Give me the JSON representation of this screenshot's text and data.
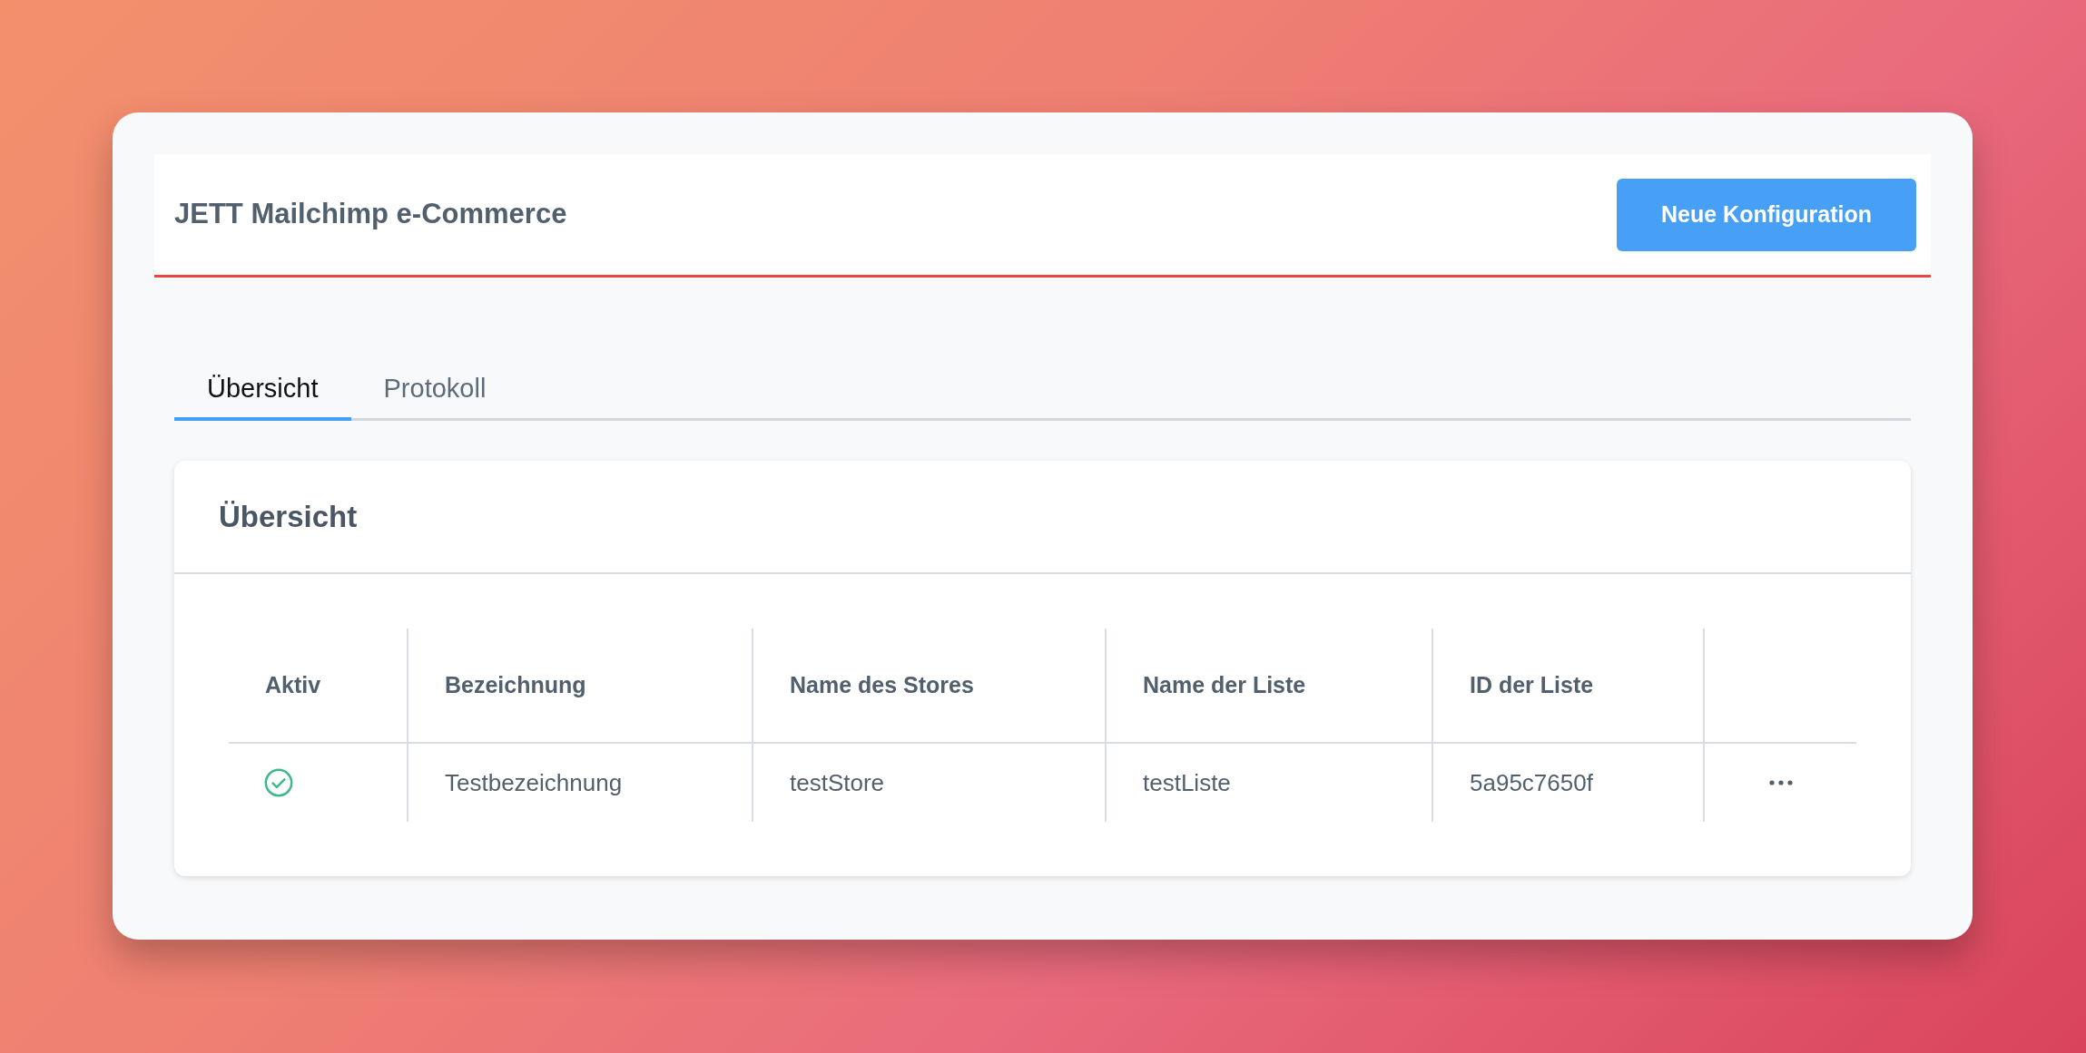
{
  "header": {
    "title": "JETT Mailchimp e-Commerce",
    "button": "Neue Konfiguration"
  },
  "tabs": [
    {
      "label": "Übersicht",
      "selected": true
    },
    {
      "label": "Protokoll",
      "selected": false
    }
  ],
  "panel": {
    "title": "Übersicht",
    "table": {
      "columns": [
        "Aktiv",
        "Bezeichnung",
        "Name des Stores",
        "Name der Liste",
        "ID der Liste"
      ],
      "rows": [
        {
          "cells": [
            {
              "kind": "status",
              "active": true
            },
            {
              "kind": "text",
              "text": "Testbezeichnung"
            },
            {
              "kind": "text",
              "text": "testStore"
            },
            {
              "kind": "text",
              "text": "testListe"
            },
            {
              "kind": "text",
              "text": "5a95c7650f"
            }
          ]
        }
      ]
    }
  }
}
